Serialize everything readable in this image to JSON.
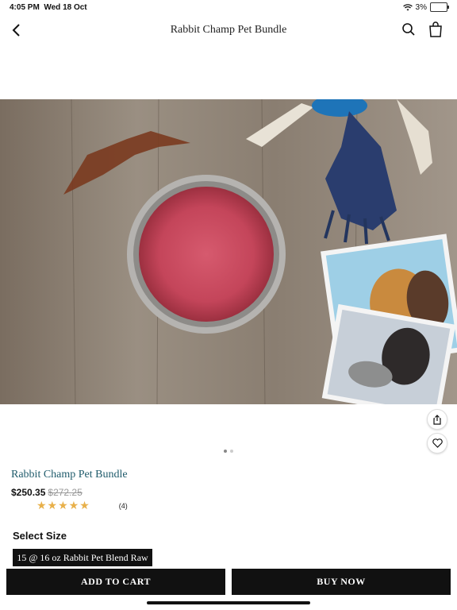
{
  "status": {
    "time": "4:05 PM",
    "date": "Wed 18 Oct",
    "battery": "3%"
  },
  "nav": {
    "title": "Rabbit Champ Pet Bundle"
  },
  "product": {
    "name": "Rabbit Champ Pet Bundle",
    "price": "$250.35",
    "old_price": "$272.25",
    "rating_stars": 5,
    "review_count": "(4)"
  },
  "size": {
    "label": "Select Size",
    "selected": "15 @ 16 oz Rabbit Pet Blend Raw"
  },
  "cta": {
    "add_to_cart": "ADD TO CART",
    "buy_now": "BUY NOW"
  },
  "carousel": {
    "pages": 2,
    "active": 1
  },
  "colors": {
    "title_teal": "#1f5b6b",
    "star": "#e8b04a",
    "button_bg": "#111111"
  }
}
